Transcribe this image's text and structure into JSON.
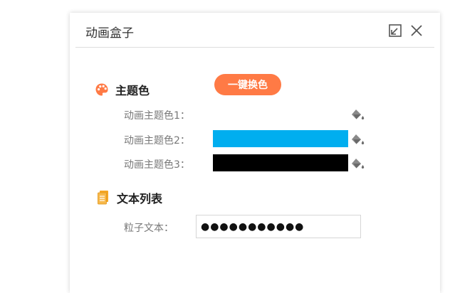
{
  "window": {
    "title": "动画盒子"
  },
  "theme": {
    "section_label": "主题色",
    "swap_button": "一键换色",
    "colors": [
      {
        "label": "动画主题色1：",
        "value": "#ffffff"
      },
      {
        "label": "动画主题色2：",
        "value": "#00aeef"
      },
      {
        "label": "动画主题色3：",
        "value": "#000000"
      }
    ]
  },
  "text_list": {
    "section_label": "文本列表",
    "field_label": "粒子文本：",
    "field_value": "●●●●●●●●●●●"
  },
  "icons": {
    "restore": "restore-window-icon",
    "close": "close-icon",
    "palette": "palette-icon",
    "document": "document-icon",
    "paint_bucket": "paint-bucket-icon"
  },
  "accent_colors": {
    "swap_button": "#ff7a45",
    "palette": "#ff7a45",
    "document": "#f5a623"
  }
}
